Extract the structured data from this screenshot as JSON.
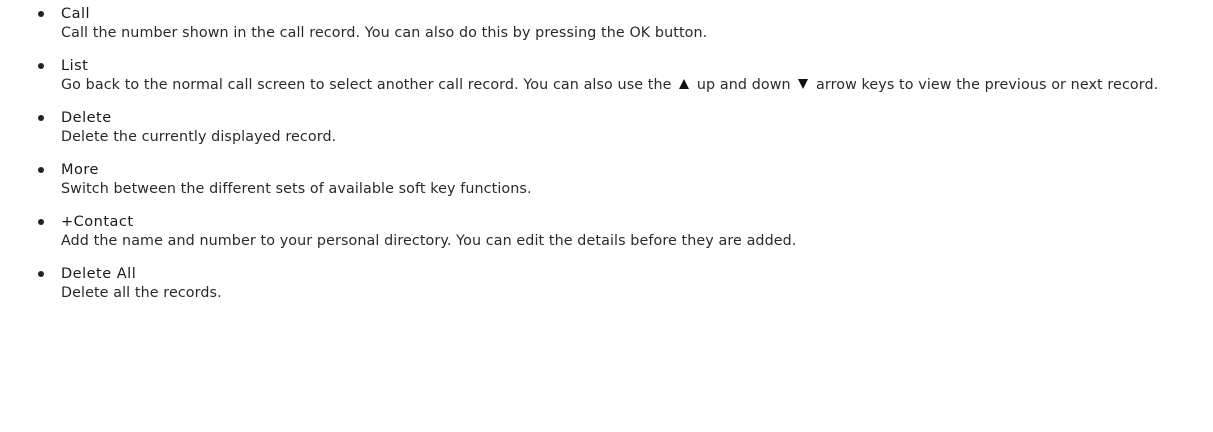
{
  "items": [
    {
      "term": "Call",
      "description": "Call the number shown in the call record. You can also do this by pressing the OK button."
    },
    {
      "term": "List",
      "description_part1": "Go back to the normal call screen to select another call record. You can also use the",
      "up_arrow_icon": "up-arrow-icon",
      "description_part2": "up and down",
      "down_arrow_icon": "down-arrow-icon",
      "description_part3": "arrow keys to view the previous or next record."
    },
    {
      "term": "Delete",
      "description": "Delete the currently displayed record."
    },
    {
      "term": "More",
      "description": "Switch between the different sets of available soft key functions."
    },
    {
      "term": "+Contact",
      "description": "Add the name and number to your personal directory. You can edit the details before they are added."
    },
    {
      "term": "Delete All",
      "description": "Delete all the records."
    }
  ]
}
